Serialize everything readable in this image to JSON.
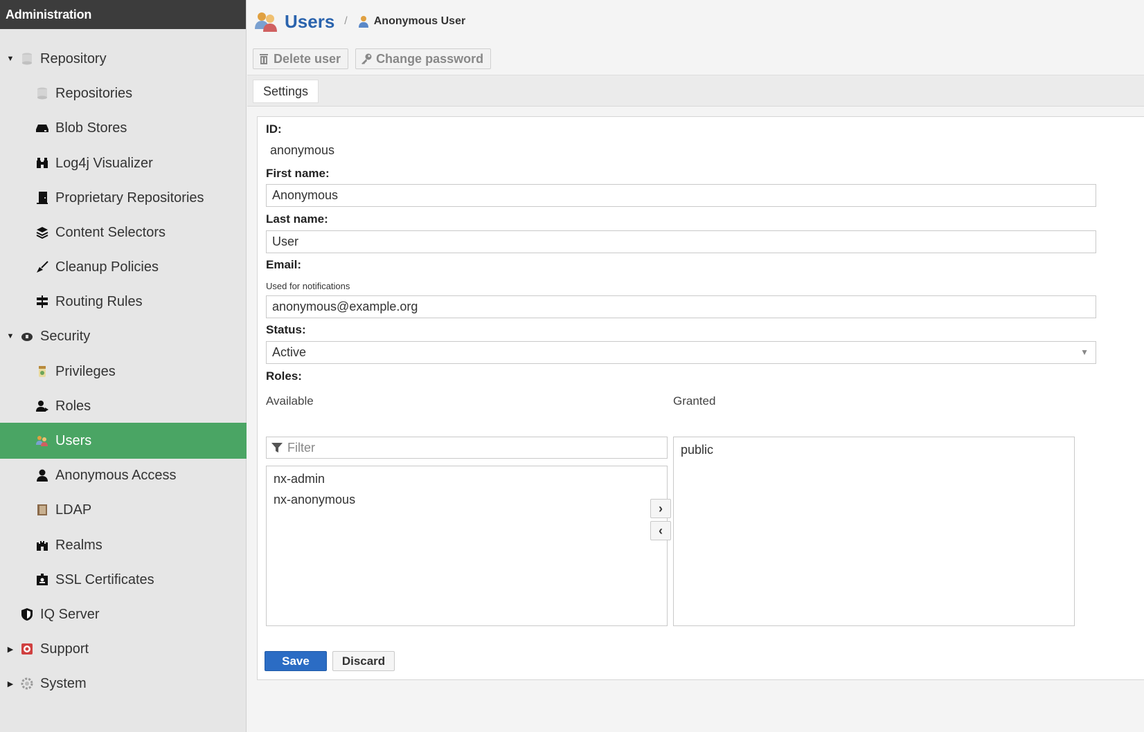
{
  "sidebar": {
    "header": "Administration",
    "items": [
      {
        "label": "Repository"
      },
      {
        "label": "Repositories"
      },
      {
        "label": "Blob Stores"
      },
      {
        "label": "Log4j Visualizer"
      },
      {
        "label": "Proprietary Repositories"
      },
      {
        "label": "Content Selectors"
      },
      {
        "label": "Cleanup Policies"
      },
      {
        "label": "Routing Rules"
      },
      {
        "label": "Security"
      },
      {
        "label": "Privileges"
      },
      {
        "label": "Roles"
      },
      {
        "label": "Users"
      },
      {
        "label": "Anonymous Access"
      },
      {
        "label": "LDAP"
      },
      {
        "label": "Realms"
      },
      {
        "label": "SSL Certificates"
      },
      {
        "label": "IQ Server"
      },
      {
        "label": "Support"
      },
      {
        "label": "System"
      }
    ]
  },
  "header": {
    "title": "Users",
    "separator": "/",
    "crumb": "Anonymous User"
  },
  "toolbar": {
    "delete_label": "Delete user",
    "change_password_label": "Change password"
  },
  "tabs": [
    {
      "label": "Settings"
    }
  ],
  "form": {
    "id_label": "ID:",
    "id_value": "anonymous",
    "first_name_label": "First name:",
    "first_name_value": "Anonymous",
    "last_name_label": "Last name:",
    "last_name_value": "User",
    "email_label": "Email:",
    "email_help": "Used for notifications",
    "email_value": "anonymous@example.org",
    "status_label": "Status:",
    "status_value": "Active",
    "roles_label": "Roles:",
    "available_label": "Available",
    "granted_label": "Granted",
    "filter_placeholder": "Filter",
    "available": [
      "nx-admin",
      "nx-anonymous"
    ],
    "granted": [
      "public"
    ],
    "add_symbol": "›",
    "remove_symbol": "‹",
    "save_label": "Save",
    "discard_label": "Discard"
  },
  "colors": {
    "sidebar_active": "#4aa564",
    "header_bg": "#3c3c3c",
    "primary": "#2b6cc4",
    "title": "#2a63ad"
  }
}
